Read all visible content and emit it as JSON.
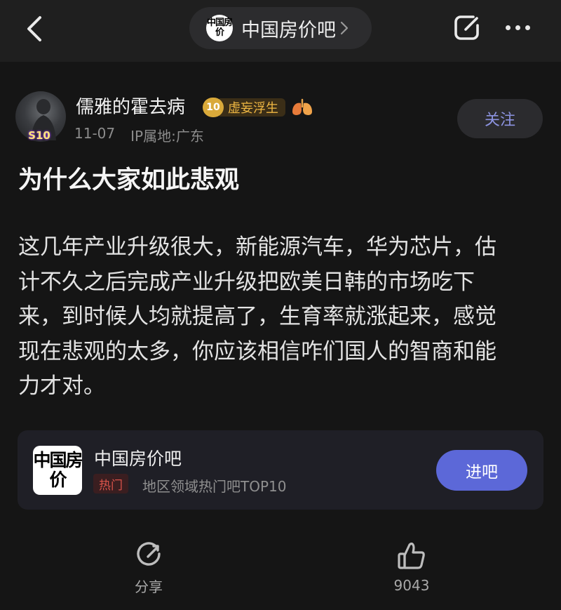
{
  "header": {
    "forum_logo_text": "中国房价",
    "title": "中国房价吧"
  },
  "author": {
    "name": "儒雅的霍去病",
    "avatar_badge": "S10",
    "level_number": "10",
    "level_title": "虚妄浮生",
    "date": "11-07",
    "ip_location": "IP属地:广东",
    "follow_label": "关注"
  },
  "post": {
    "title": "为什么大家如此悲观",
    "body_lines": [
      "这几年产业升级很大，新能源汽车，华为芯片，估",
      "计不久之后完成产业升级把欧美日韩的市场吃下",
      "来，到时候人均就提高了，生育率就涨起来，感觉",
      "现在悲观的太多，你应该相信咋们国人的智商和能",
      "力才对。"
    ]
  },
  "forum_card": {
    "logo_text": "中国房价",
    "name": "中国房价吧",
    "tag": "热门",
    "description": "地区领域热门吧TOP10",
    "enter_label": "进吧"
  },
  "actions": {
    "share_label": "分享",
    "like_count": "9043"
  },
  "colors": {
    "background": "#151515",
    "accent": "#5c68d8",
    "level_gold": "#f0b843",
    "hot_red": "#d9534a"
  }
}
